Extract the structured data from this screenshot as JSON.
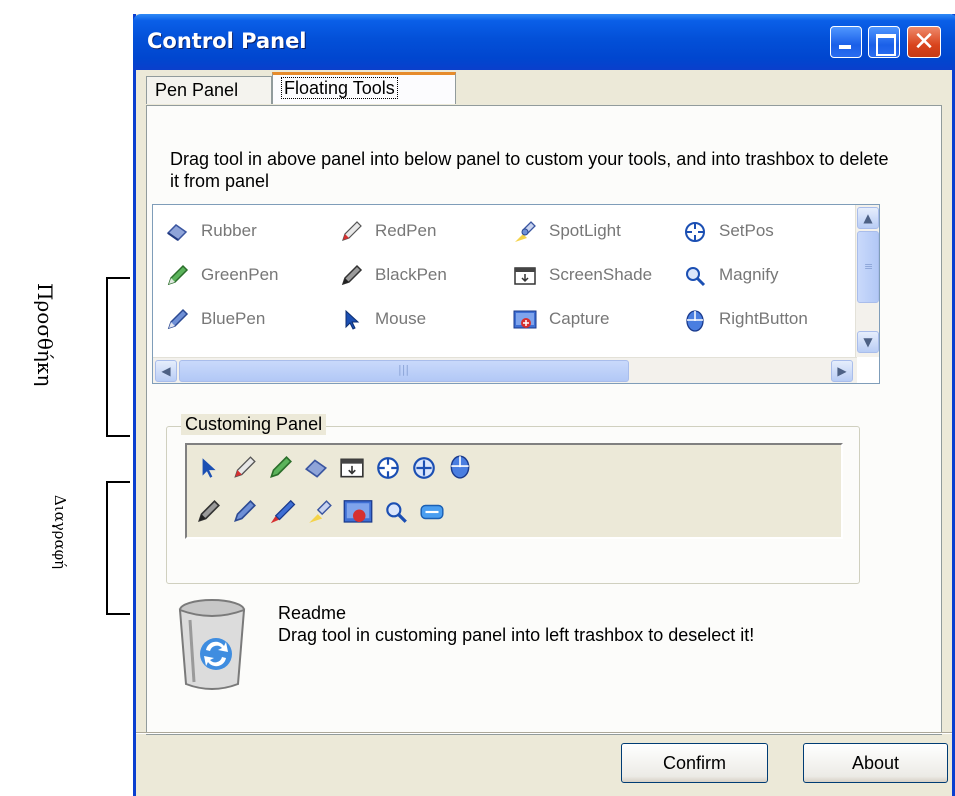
{
  "annotations": {
    "storage": "Προσθήκη",
    "delete": "Διαγραφή"
  },
  "window": {
    "title": "Control Panel",
    "close_glyph": "✕"
  },
  "tabs": [
    {
      "label": "Pen Panel",
      "active": false
    },
    {
      "label": "Floating Tools",
      "active": true
    }
  ],
  "instructions": "Drag tool in above panel into below panel to custom your tools, and into trashbox to delete it from panel",
  "tools": [
    {
      "label": "Rubber",
      "icon": "rubber-icon"
    },
    {
      "label": "RedPen",
      "icon": "red-pen-icon"
    },
    {
      "label": "SpotLight",
      "icon": "spotlight-icon"
    },
    {
      "label": "SetPos",
      "icon": "setpos-icon"
    },
    {
      "label": "GreenPen",
      "icon": "green-pen-icon"
    },
    {
      "label": "BlackPen",
      "icon": "black-pen-icon"
    },
    {
      "label": "ScreenShade",
      "icon": "screenshade-icon"
    },
    {
      "label": "Magnify",
      "icon": "magnify-icon"
    },
    {
      "label": "BluePen",
      "icon": "blue-pen-icon"
    },
    {
      "label": "Mouse",
      "icon": "mouse-cursor-icon"
    },
    {
      "label": "Capture",
      "icon": "capture-icon"
    },
    {
      "label": "RightButton",
      "icon": "right-button-icon"
    }
  ],
  "customing_panel": {
    "label": "Customing Panel",
    "row1_icons": [
      "mouse-cursor-icon",
      "red-pen-icon",
      "green-pen-icon",
      "rubber-icon",
      "screenshade-icon",
      "setpos-icon",
      "setpos-icon",
      "right-button-icon"
    ],
    "row2_icons": [
      "black-pen-icon",
      "blue-pen-icon",
      "brush-icon",
      "spotlight-icon",
      "capture-icon",
      "magnify-icon",
      "keyboard-icon"
    ]
  },
  "readme": {
    "title": "Readme",
    "body": "Drag tool in customing panel into left trashbox to deselect it!"
  },
  "buttons": {
    "confirm": "Confirm",
    "about": "About"
  }
}
